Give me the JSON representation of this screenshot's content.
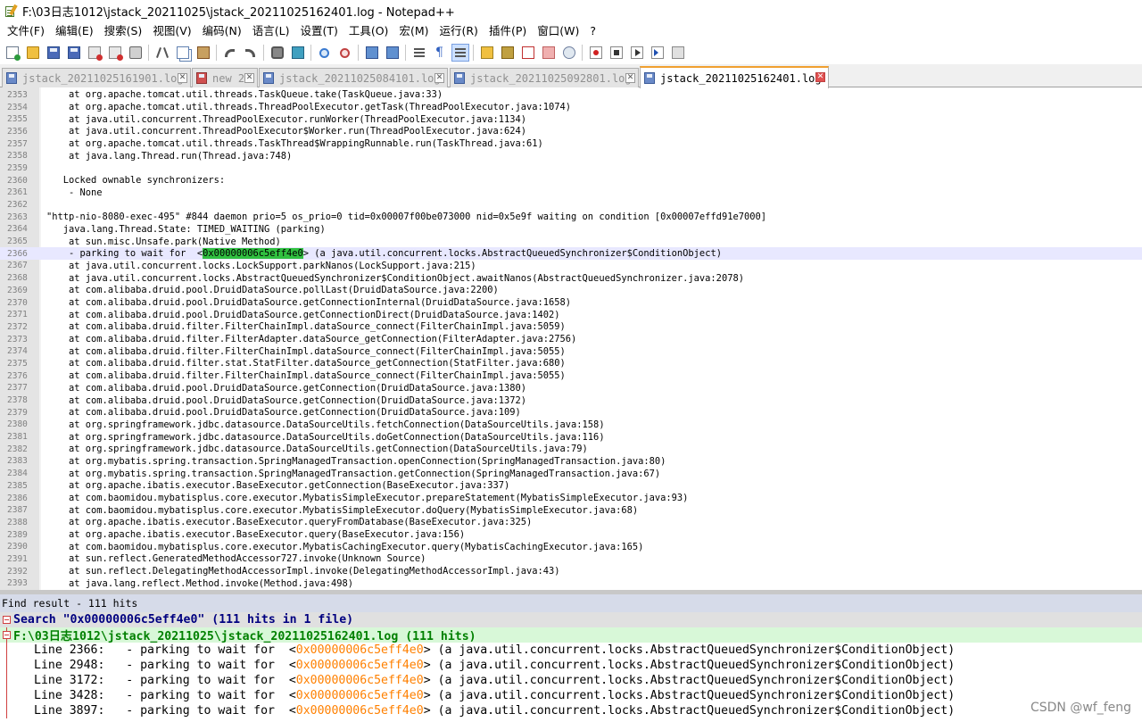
{
  "window": {
    "title": "F:\\03日志1012\\jstack_20211025\\jstack_20211025162401.log - Notepad++"
  },
  "menu": [
    "文件(F)",
    "编辑(E)",
    "搜索(S)",
    "视图(V)",
    "编码(N)",
    "语言(L)",
    "设置(T)",
    "工具(O)",
    "宏(M)",
    "运行(R)",
    "插件(P)",
    "窗口(W)",
    "?"
  ],
  "toolbar": {
    "icons": [
      "new-file-icon",
      "open-file-icon",
      "save-icon",
      "save-all-icon",
      "close-icon",
      "close-all-icon",
      "print-icon",
      "cut-icon",
      "copy-icon",
      "paste-icon",
      "undo-icon",
      "redo-icon",
      "find-icon",
      "replace-icon",
      "zoom-in-icon",
      "zoom-out-icon",
      "sync-vertical-icon",
      "sync-horizontal-icon",
      "word-wrap-icon",
      "show-all-chars-icon",
      "indent-guide-icon",
      "user-lang-icon",
      "doc-map-icon",
      "function-list-icon",
      "folder-as-workspace-icon",
      "monitoring-icon",
      "record-macro-icon",
      "stop-macro-icon",
      "play-macro-icon",
      "run-macro-multiple-icon",
      "save-macro-icon"
    ]
  },
  "tabs": [
    {
      "label": "jstack_20211025161901.log",
      "active": false,
      "saved": true
    },
    {
      "label": "new 2",
      "active": false,
      "saved": false
    },
    {
      "label": "jstack_20211025084101.log",
      "active": false,
      "saved": true
    },
    {
      "label": "jstack_20211025092801.log",
      "active": false,
      "saved": true
    },
    {
      "label": "jstack_20211025162401.log",
      "active": true,
      "saved": true
    }
  ],
  "editor": {
    "current_line": "2366",
    "highlight_term": "0x00000006c5eff4e0",
    "lines": [
      {
        "n": "2353",
        "text": "\tat org.apache.tomcat.util.threads.TaskQueue.take(TaskQueue.java:33)"
      },
      {
        "n": "2354",
        "text": "\tat org.apache.tomcat.util.threads.ThreadPoolExecutor.getTask(ThreadPoolExecutor.java:1074)"
      },
      {
        "n": "2355",
        "text": "\tat java.util.concurrent.ThreadPoolExecutor.runWorker(ThreadPoolExecutor.java:1134)"
      },
      {
        "n": "2356",
        "text": "\tat java.util.concurrent.ThreadPoolExecutor$Worker.run(ThreadPoolExecutor.java:624)"
      },
      {
        "n": "2357",
        "text": "\tat org.apache.tomcat.util.threads.TaskThread$WrappingRunnable.run(TaskThread.java:61)"
      },
      {
        "n": "2358",
        "text": "\tat java.lang.Thread.run(Thread.java:748)"
      },
      {
        "n": "2359",
        "text": ""
      },
      {
        "n": "2360",
        "text": "   Locked ownable synchronizers:"
      },
      {
        "n": "2361",
        "text": "\t- None"
      },
      {
        "n": "2362",
        "text": ""
      },
      {
        "n": "2363",
        "text": "\"http-nio-8080-exec-495\" #844 daemon prio=5 os_prio=0 tid=0x00007f00be073000 nid=0x5e9f waiting on condition [0x00007effd91e7000]"
      },
      {
        "n": "2364",
        "text": "   java.lang.Thread.State: TIMED_WAITING (parking)"
      },
      {
        "n": "2365",
        "text": "\tat sun.misc.Unsafe.park(Native Method)"
      },
      {
        "n": "2366",
        "pre": "\t- parking to wait for  <",
        "hit": "0x00000006c5eff4e0",
        "post": "> (a java.util.concurrent.locks.AbstractQueuedSynchronizer$ConditionObject)"
      },
      {
        "n": "2367",
        "text": "\tat java.util.concurrent.locks.LockSupport.parkNanos(LockSupport.java:215)"
      },
      {
        "n": "2368",
        "text": "\tat java.util.concurrent.locks.AbstractQueuedSynchronizer$ConditionObject.awaitNanos(AbstractQueuedSynchronizer.java:2078)"
      },
      {
        "n": "2369",
        "text": "\tat com.alibaba.druid.pool.DruidDataSource.pollLast(DruidDataSource.java:2200)"
      },
      {
        "n": "2370",
        "text": "\tat com.alibaba.druid.pool.DruidDataSource.getConnectionInternal(DruidDataSource.java:1658)"
      },
      {
        "n": "2371",
        "text": "\tat com.alibaba.druid.pool.DruidDataSource.getConnectionDirect(DruidDataSource.java:1402)"
      },
      {
        "n": "2372",
        "text": "\tat com.alibaba.druid.filter.FilterChainImpl.dataSource_connect(FilterChainImpl.java:5059)"
      },
      {
        "n": "2373",
        "text": "\tat com.alibaba.druid.filter.FilterAdapter.dataSource_getConnection(FilterAdapter.java:2756)"
      },
      {
        "n": "2374",
        "text": "\tat com.alibaba.druid.filter.FilterChainImpl.dataSource_connect(FilterChainImpl.java:5055)"
      },
      {
        "n": "2375",
        "text": "\tat com.alibaba.druid.filter.stat.StatFilter.dataSource_getConnection(StatFilter.java:680)"
      },
      {
        "n": "2376",
        "text": "\tat com.alibaba.druid.filter.FilterChainImpl.dataSource_connect(FilterChainImpl.java:5055)"
      },
      {
        "n": "2377",
        "text": "\tat com.alibaba.druid.pool.DruidDataSource.getConnection(DruidDataSource.java:1380)"
      },
      {
        "n": "2378",
        "text": "\tat com.alibaba.druid.pool.DruidDataSource.getConnection(DruidDataSource.java:1372)"
      },
      {
        "n": "2379",
        "text": "\tat com.alibaba.druid.pool.DruidDataSource.getConnection(DruidDataSource.java:109)"
      },
      {
        "n": "2380",
        "text": "\tat org.springframework.jdbc.datasource.DataSourceUtils.fetchConnection(DataSourceUtils.java:158)"
      },
      {
        "n": "2381",
        "text": "\tat org.springframework.jdbc.datasource.DataSourceUtils.doGetConnection(DataSourceUtils.java:116)"
      },
      {
        "n": "2382",
        "text": "\tat org.springframework.jdbc.datasource.DataSourceUtils.getConnection(DataSourceUtils.java:79)"
      },
      {
        "n": "2383",
        "text": "\tat org.mybatis.spring.transaction.SpringManagedTransaction.openConnection(SpringManagedTransaction.java:80)"
      },
      {
        "n": "2384",
        "text": "\tat org.mybatis.spring.transaction.SpringManagedTransaction.getConnection(SpringManagedTransaction.java:67)"
      },
      {
        "n": "2385",
        "text": "\tat org.apache.ibatis.executor.BaseExecutor.getConnection(BaseExecutor.java:337)"
      },
      {
        "n": "2386",
        "text": "\tat com.baomidou.mybatisplus.core.executor.MybatisSimpleExecutor.prepareStatement(MybatisSimpleExecutor.java:93)"
      },
      {
        "n": "2387",
        "text": "\tat com.baomidou.mybatisplus.core.executor.MybatisSimpleExecutor.doQuery(MybatisSimpleExecutor.java:68)"
      },
      {
        "n": "2388",
        "text": "\tat org.apache.ibatis.executor.BaseExecutor.queryFromDatabase(BaseExecutor.java:325)"
      },
      {
        "n": "2389",
        "text": "\tat org.apache.ibatis.executor.BaseExecutor.query(BaseExecutor.java:156)"
      },
      {
        "n": "2390",
        "text": "\tat com.baomidou.mybatisplus.core.executor.MybatisCachingExecutor.query(MybatisCachingExecutor.java:165)"
      },
      {
        "n": "2391",
        "text": "\tat sun.reflect.GeneratedMethodAccessor727.invoke(Unknown Source)"
      },
      {
        "n": "2392",
        "text": "\tat sun.reflect.DelegatingMethodAccessorImpl.invoke(DelegatingMethodAccessorImpl.java:43)"
      },
      {
        "n": "2393",
        "text": "\tat java.lang.reflect.Method.invoke(Method.java:498)"
      }
    ]
  },
  "find_results": {
    "caption": "Find result - 111 hits",
    "search_line": "Search \"0x00000006c5eff4e0\" (111 hits in 1 file)",
    "file_line": "F:\\03日志1012\\jstack_20211025\\jstack_20211025162401.log (111 hits)",
    "hits": [
      {
        "prefix": "Line 2366:   - parking to wait for  <",
        "term": "0x00000006c5eff4e0",
        "suffix": "> (a java.util.concurrent.locks.AbstractQueuedSynchronizer$ConditionObject)"
      },
      {
        "prefix": "Line 2948:   - parking to wait for  <",
        "term": "0x00000006c5eff4e0",
        "suffix": "> (a java.util.concurrent.locks.AbstractQueuedSynchronizer$ConditionObject)"
      },
      {
        "prefix": "Line 3172:   - parking to wait for  <",
        "term": "0x00000006c5eff4e0",
        "suffix": "> (a java.util.concurrent.locks.AbstractQueuedSynchronizer$ConditionObject)"
      },
      {
        "prefix": "Line 3428:   - parking to wait for  <",
        "term": "0x00000006c5eff4e0",
        "suffix": "> (a java.util.concurrent.locks.AbstractQueuedSynchronizer$ConditionObject)"
      },
      {
        "prefix": "Line 3897:   - parking to wait for  <",
        "term": "0x00000006c5eff4e0",
        "suffix": "> (a java.util.concurrent.locks.AbstractQueuedSynchronizer$ConditionObject)"
      }
    ]
  },
  "watermark": "CSDN @wf_feng",
  "colors": {
    "hit_highlight": "#30c040",
    "find_term": "#ff8000",
    "current_line": "#e8e8ff",
    "active_tab_accent": "#f0a030"
  }
}
